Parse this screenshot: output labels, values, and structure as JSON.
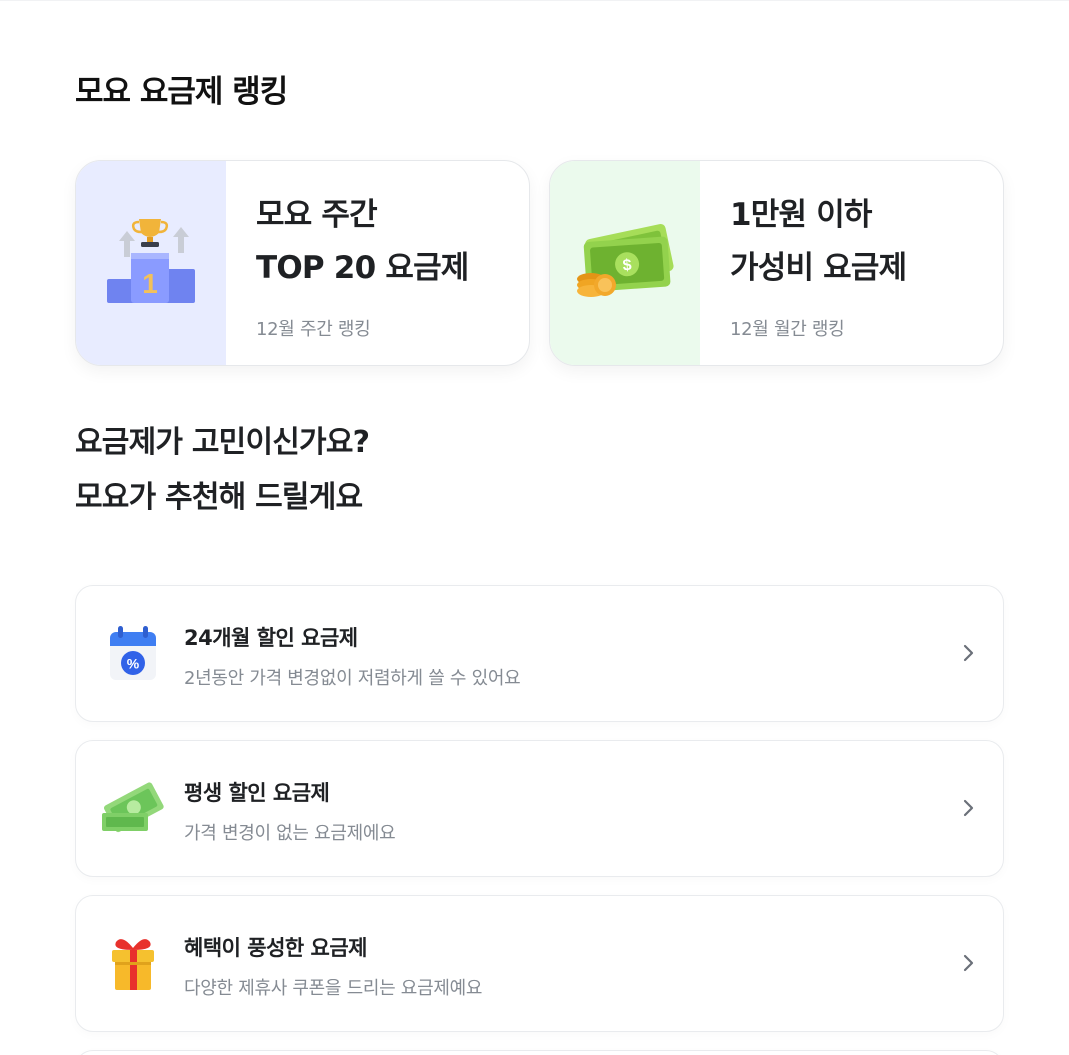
{
  "section": {
    "title": "모요 요금제 랭킹"
  },
  "ranking_cards": [
    {
      "line1": "모요 주간",
      "line2": "TOP 20 요금제",
      "sub": "12월 주간 랭킹",
      "icon": "trophy-podium-icon"
    },
    {
      "line1": "1만원 이하",
      "line2": "가성비 요금제",
      "sub": "12월 월간 랭킹",
      "icon": "cash-money-icon"
    }
  ],
  "recommend": {
    "line1": "요금제가 고민이신가요?",
    "line2": "모요가 추천해 드릴게요"
  },
  "plans": [
    {
      "title": "24개월 할인 요금제",
      "desc": "2년동안 가격 변경없이 저렴하게 쓸 수 있어요",
      "icon": "calendar-discount-icon"
    },
    {
      "title": "평생 할인 요금제",
      "desc": "가격 변경이 없는 요금제에요",
      "icon": "money-bill-icon"
    },
    {
      "title": "혜택이 풍성한 요금제",
      "desc": "다양한 제휴사 쿠폰을 드리는 요금제예요",
      "icon": "gift-box-icon"
    }
  ]
}
